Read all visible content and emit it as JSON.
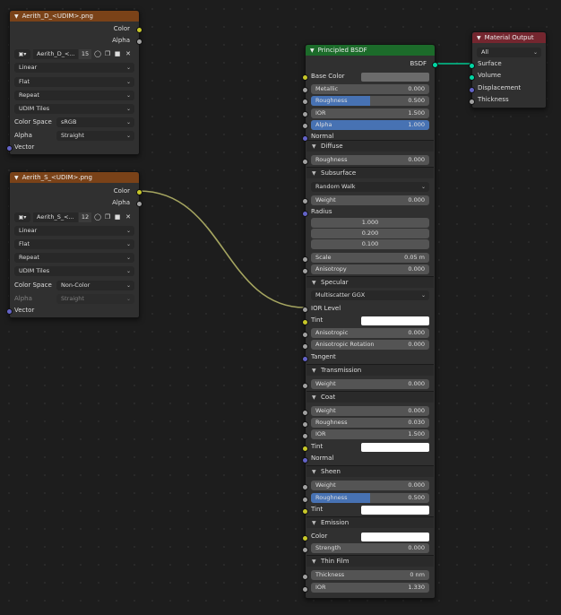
{
  "colors": {
    "texture_header": "#7a4218",
    "bsdf_header": "#1c6b2a",
    "output_header": "#74262f",
    "link_yellow": "#c7c729",
    "link_grey": "#a1a1a1"
  },
  "tex1": {
    "title": "Aerith_D_<UDIM>.png",
    "outputs": [
      "Color",
      "Alpha"
    ],
    "image_name": "Aerith_D_<...",
    "users": "15",
    "interpolation": "Linear",
    "projection": "Flat",
    "extension": "Repeat",
    "source": "UDIM Tiles",
    "colorspace_label": "Color Space",
    "colorspace": "sRGB",
    "alpha_label": "Alpha",
    "alpha": "Straight",
    "input": "Vector"
  },
  "tex2": {
    "title": "Aerith_S_<UDIM>.png",
    "outputs": [
      "Color",
      "Alpha"
    ],
    "image_name": "Aerith_S_<...",
    "users": "12",
    "interpolation": "Linear",
    "projection": "Flat",
    "extension": "Repeat",
    "source": "UDIM Tiles",
    "colorspace_label": "Color Space",
    "colorspace": "Non-Color",
    "alpha_label": "Alpha",
    "alpha": "Straight",
    "input": "Vector"
  },
  "bsdf": {
    "title": "Principled BSDF",
    "output": "BSDF",
    "base_color": "Base Color",
    "metallic": {
      "label": "Metallic",
      "value": "0.000"
    },
    "roughness": {
      "label": "Roughness",
      "value": "0.500",
      "fraction": 0.5
    },
    "ior": {
      "label": "IOR",
      "value": "1.500"
    },
    "alpha": {
      "label": "Alpha",
      "value": "1.000",
      "fraction": 1.0
    },
    "normal": "Normal",
    "diffuse": {
      "title": "Diffuse",
      "roughness_label": "Roughness",
      "roughness": "0.000"
    },
    "subsurface": {
      "title": "Subsurface",
      "method": "Random Walk",
      "weight_label": "Weight",
      "weight": "0.000",
      "radius_label": "Radius",
      "radius": [
        "1.000",
        "0.200",
        "0.100"
      ],
      "scale_label": "Scale",
      "scale": "0.05 m",
      "aniso_label": "Anisotropy",
      "aniso": "0.000"
    },
    "specular": {
      "title": "Specular",
      "distribution": "Multiscatter GGX",
      "ior_level": "IOR Level",
      "tint": "Tint",
      "anisotropic_label": "Anisotropic",
      "anisotropic": "0.000",
      "rotation_label": "Anisotropic Rotation",
      "rotation": "0.000",
      "tangent": "Tangent"
    },
    "transmission": {
      "title": "Transmission",
      "weight_label": "Weight",
      "weight": "0.000"
    },
    "coat": {
      "title": "Coat",
      "weight_label": "Weight",
      "weight": "0.000",
      "roughness_label": "Roughness",
      "roughness": "0.030",
      "ior_label": "IOR",
      "ior": "1.500",
      "tint": "Tint",
      "normal": "Normal"
    },
    "sheen": {
      "title": "Sheen",
      "weight_label": "Weight",
      "weight": "0.000",
      "roughness_label": "Roughness",
      "roughness": "0.500",
      "roughness_fraction": 0.5,
      "tint": "Tint"
    },
    "emission": {
      "title": "Emission",
      "color": "Color",
      "strength_label": "Strength",
      "strength": "0.000"
    },
    "thinfilm": {
      "title": "Thin Film",
      "thickness_label": "Thickness",
      "thickness": "0 nm",
      "ior_label": "IOR",
      "ior": "1.330"
    }
  },
  "output": {
    "title": "Material Output",
    "target": "All",
    "inputs": [
      "Surface",
      "Volume",
      "Displacement",
      "Thickness"
    ]
  }
}
